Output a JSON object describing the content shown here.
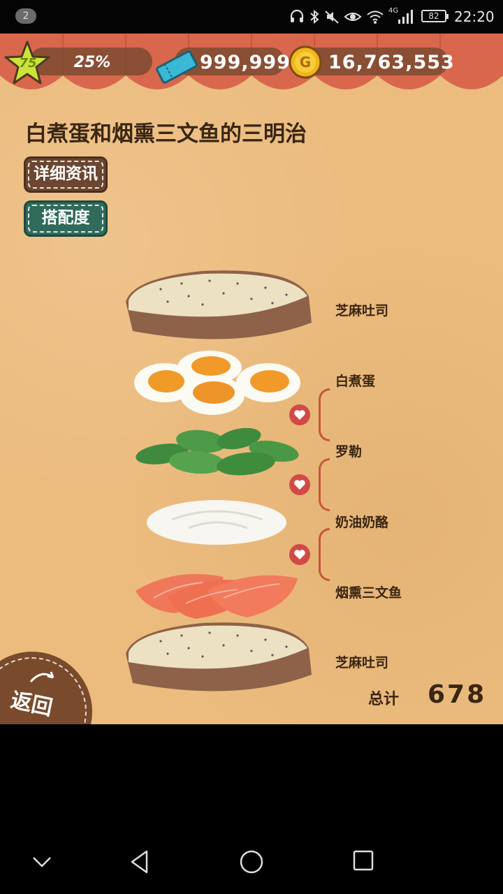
{
  "status_bar": {
    "notification_count": "2",
    "battery": "82",
    "time": "22:20",
    "network": "4G",
    "icons": [
      "headset-icon",
      "bluetooth-icon",
      "mute-icon",
      "eye-icon",
      "wifi-icon",
      "signal-icon",
      "battery-icon"
    ]
  },
  "hud": {
    "level": "75",
    "progress_text": "25%",
    "tickets": "999,999",
    "coins": "16,763,553",
    "coin_symbol": "G"
  },
  "recipe": {
    "title": "白煮蛋和烟熏三文鱼的三明治",
    "detail_button": "详细资讯",
    "match_button": "搭配度"
  },
  "ingredients": [
    {
      "label": "芝麻吐司"
    },
    {
      "label": "白煮蛋"
    },
    {
      "label": "罗勒"
    },
    {
      "label": "奶油奶酪"
    },
    {
      "label": "烟熏三文鱼"
    },
    {
      "label": "芝麻吐司"
    }
  ],
  "total": {
    "label": "总计",
    "value": "678"
  },
  "back_button": "返回",
  "colors": {
    "background": "#ecbc7f",
    "awning_red": "#d8674d",
    "heart_red": "#d24a45",
    "detail_button": "#6b4630",
    "match_button": "#2f6a5a"
  }
}
